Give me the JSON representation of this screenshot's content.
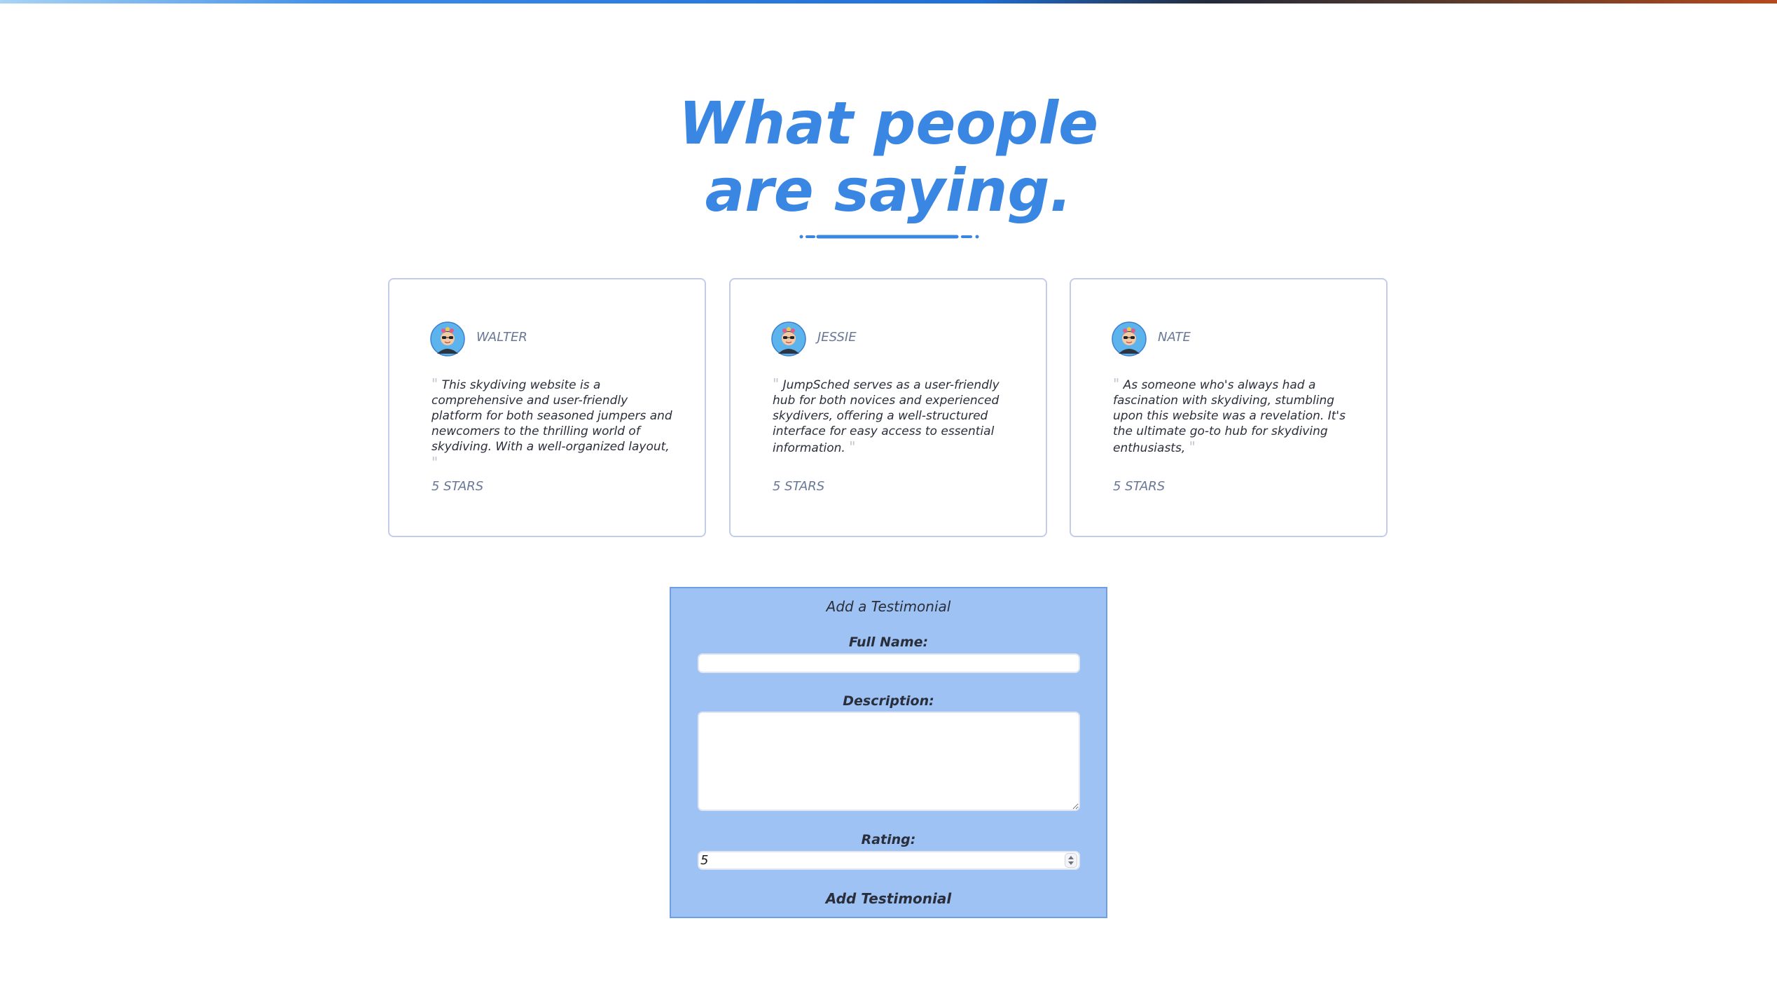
{
  "section": {
    "heading_line1": "What people",
    "heading_line2": "are saying."
  },
  "testimonials": [
    {
      "name": "WALTER",
      "text": "This skydiving website is a comprehensive and user-friendly platform for both seasoned jumpers and newcomers to the thrilling world of skydiving. With a well-organized layout,",
      "rating": "5 STARS"
    },
    {
      "name": "JESSIE",
      "text": "JumpSched serves as a user-friendly hub for both novices and experienced skydivers, offering a well-structured interface for easy access to essential information.",
      "rating": "5 STARS"
    },
    {
      "name": "NATE",
      "text": "As someone who's always had a fascination with skydiving, stumbling upon this website was a revelation. It's the ultimate go-to hub for skydiving enthusiasts,",
      "rating": "5 STARS"
    }
  ],
  "form": {
    "title": "Add a Testimonial",
    "name_label": "Full Name:",
    "description_label": "Description:",
    "rating_label": "Rating:",
    "rating_value": "5",
    "submit_label": "Add Testimonial"
  },
  "colors": {
    "heading": "#3a86e3",
    "form_background": "#9dc2f3",
    "card_border": "#c3cce9"
  },
  "icons": {
    "avatar": "avatar-icon",
    "quote": "quote-icon"
  }
}
